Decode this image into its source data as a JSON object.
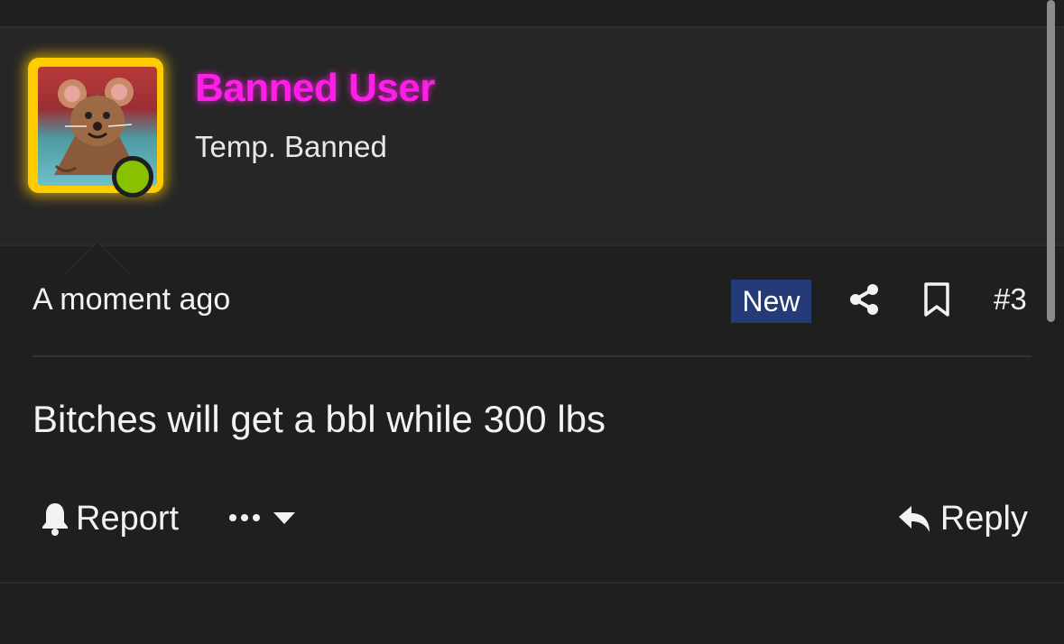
{
  "user": {
    "name": "Banned User",
    "title": "Temp. Banned",
    "online": true,
    "name_color": "#ff1ee8",
    "avatar_frame_color": "#ffcc00",
    "online_color": "#88c100"
  },
  "post": {
    "timestamp": "A moment ago",
    "badge": "New",
    "badge_color": "#253b78",
    "number": "#3",
    "body": "Bitches will get a bbl while 300 lbs"
  },
  "actions": {
    "report_label": "Report",
    "reply_label": "Reply",
    "icons": [
      "bell-icon",
      "ellipsis-icon",
      "caret-down-icon",
      "share-icon",
      "bookmark-icon",
      "reply-icon"
    ]
  }
}
